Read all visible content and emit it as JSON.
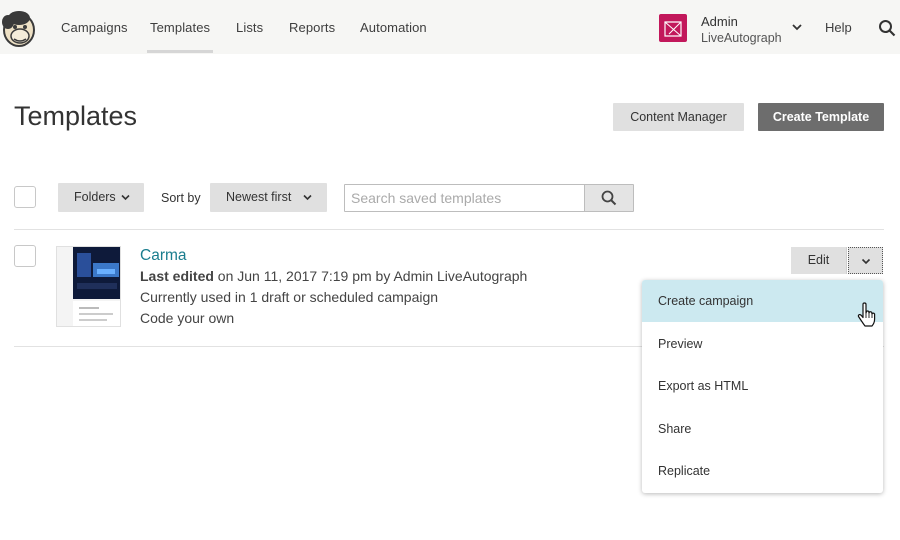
{
  "nav": {
    "items": [
      {
        "label": "Campaigns",
        "active": false
      },
      {
        "label": "Templates",
        "active": true
      },
      {
        "label": "Lists",
        "active": false
      },
      {
        "label": "Reports",
        "active": false
      },
      {
        "label": "Automation",
        "active": false
      }
    ],
    "account": {
      "name": "Admin",
      "org": "LiveAutograph",
      "chevron_icon": "chevron-down-icon"
    },
    "help": "Help",
    "search_icon": "search-icon"
  },
  "header": {
    "title": "Templates",
    "content_manager_label": "Content Manager",
    "create_template_label": "Create Template"
  },
  "toolbar": {
    "folders_label": "Folders",
    "sort_by_label": "Sort by",
    "sort_value": "Newest first",
    "search_placeholder": "Search saved templates"
  },
  "templates": [
    {
      "name": "Carma",
      "last_edited_label": "Last edited",
      "last_edited_rest": " on Jun 11, 2017 7:19 pm by Admin LiveAutograph",
      "usage": "Currently used in 1 draft or scheduled campaign",
      "type": "Code your own",
      "edit_label": "Edit"
    }
  ],
  "dropdown": {
    "items": [
      {
        "label": "Create campaign",
        "hover": true
      },
      {
        "label": "Preview",
        "hover": false
      },
      {
        "label": "Export as HTML",
        "hover": false
      },
      {
        "label": "Share",
        "hover": false
      },
      {
        "label": "Replicate",
        "hover": false
      }
    ]
  },
  "colors": {
    "nav_bg": "#f6f6f4",
    "link": "#1a7d8e",
    "primary_button": "#6d6d6d",
    "hover_row": "#cce9f0",
    "avatar": "#c2185b"
  }
}
